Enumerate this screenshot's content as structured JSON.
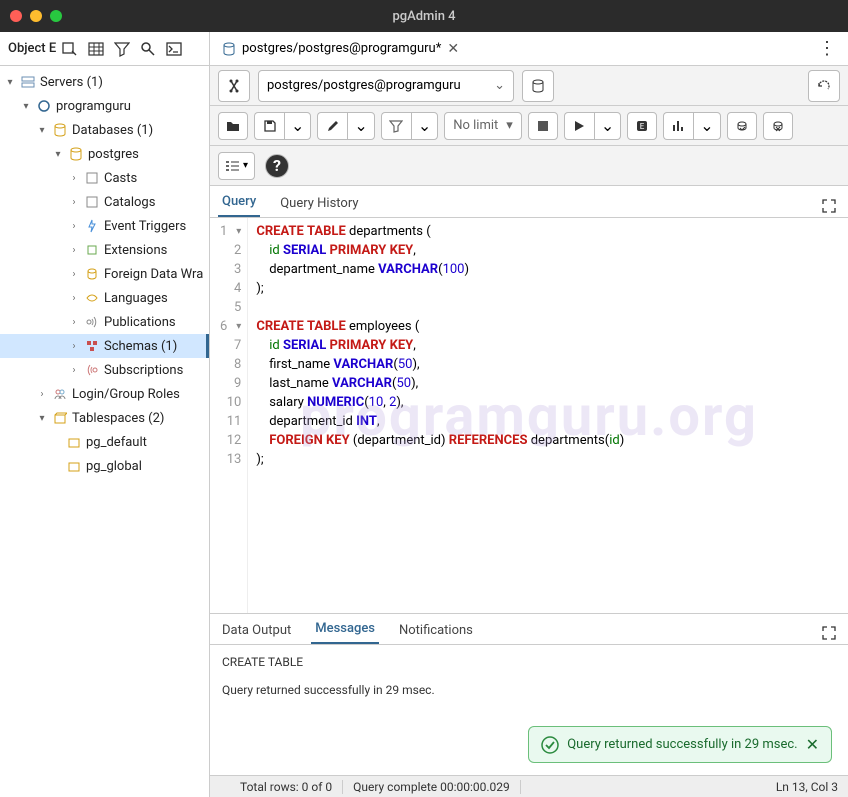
{
  "window": {
    "title": "pgAdmin 4"
  },
  "sidebar": {
    "title": "Object E",
    "tree": {
      "servers": "Servers (1)",
      "server": "programguru",
      "databases": "Databases (1)",
      "database": "postgres",
      "casts": "Casts",
      "catalogs": "Catalogs",
      "event_triggers": "Event Triggers",
      "extensions": "Extensions",
      "fdw": "Foreign Data Wra",
      "languages": "Languages",
      "publications": "Publications",
      "schemas": "Schemas (1)",
      "subscriptions": "Subscriptions",
      "login_roles": "Login/Group Roles",
      "tablespaces": "Tablespaces (2)",
      "ts_default": "pg_default",
      "ts_global": "pg_global"
    }
  },
  "tab": {
    "label": "postgres/postgres@programguru*"
  },
  "connection": {
    "value": "postgres/postgres@programguru"
  },
  "toolbar": {
    "limit": "No limit"
  },
  "query_tabs": {
    "query": "Query",
    "history": "Query History"
  },
  "output_tabs": {
    "data": "Data Output",
    "messages": "Messages",
    "notifications": "Notifications"
  },
  "messages": {
    "l1": "CREATE TABLE",
    "l2": "Query returned successfully in 29 msec."
  },
  "status": {
    "rows": "Total rows: 0 of 0",
    "complete": "Query complete 00:00:00.029",
    "cursor": "Ln 13, Col 3"
  },
  "toast": {
    "text": "Query returned successfully in 29 msec."
  },
  "watermark": "programguru.org"
}
